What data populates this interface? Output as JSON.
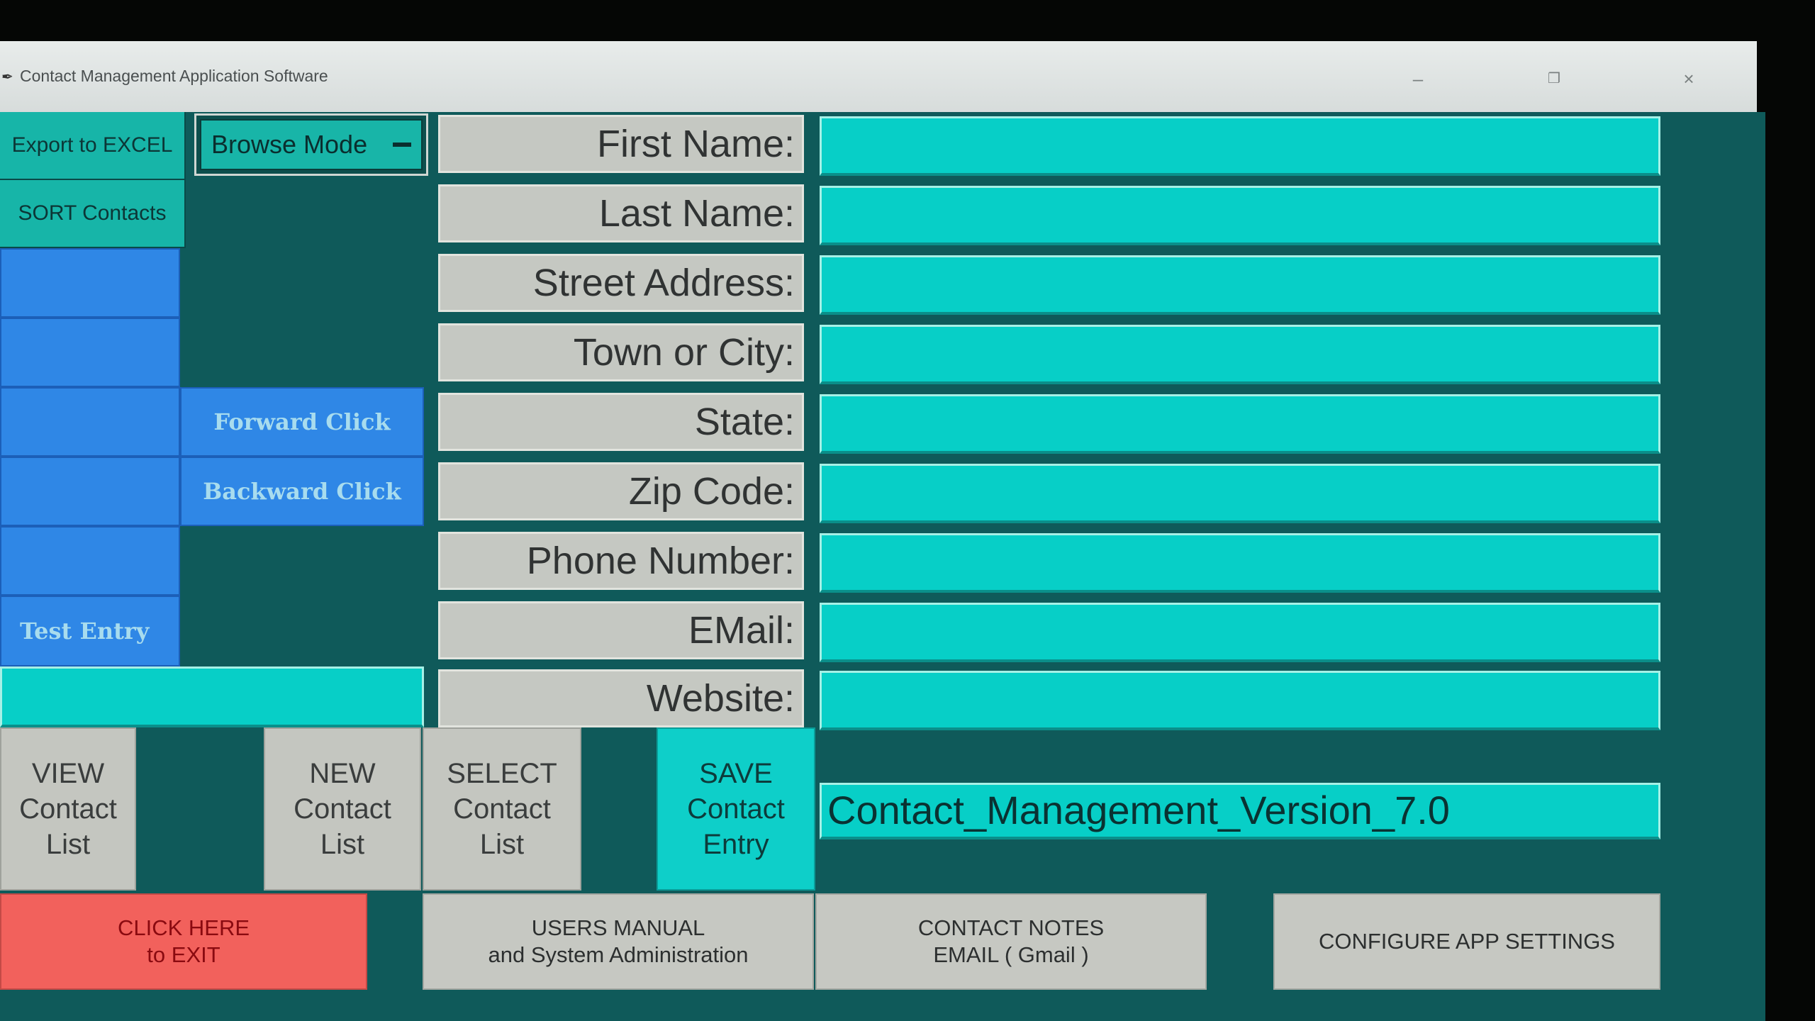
{
  "window": {
    "title": "Contact Management Application Software",
    "minimize": "–",
    "restore": "❐",
    "close": "×"
  },
  "sidebar": {
    "export_label": "Export to EXCEL",
    "sort_label": "SORT Contacts",
    "mode_select": "Browse Mode",
    "forward_label": "Forward Click",
    "backward_label": "Backward Click",
    "test_entry_label": "Test Entry"
  },
  "form": {
    "fields": [
      {
        "label": "First Name:",
        "value": ""
      },
      {
        "label": "Last Name:",
        "value": ""
      },
      {
        "label": "Street Address:",
        "value": ""
      },
      {
        "label": "Town or City:",
        "value": ""
      },
      {
        "label": "State:",
        "value": ""
      },
      {
        "label": "Zip Code:",
        "value": ""
      },
      {
        "label": "Phone Number:",
        "value": ""
      },
      {
        "label": "EMail:",
        "value": ""
      },
      {
        "label": "Website:",
        "value": ""
      }
    ],
    "version_text": "Contact_Management_Version_7.0"
  },
  "actions": {
    "view_list": "VIEW\nContact\nList",
    "new_list": "NEW\nContact\nList",
    "select_list": "SELECT\nContact\nList",
    "save_entry": "SAVE\nContact\nEntry",
    "exit": "CLICK HERE\nto EXIT",
    "manual": "USERS MANUAL\nand System Administration",
    "notes": "CONTACT NOTES\nEMAIL   ( Gmail )",
    "configure": "CONFIGURE APP SETTINGS"
  },
  "colors": {
    "background": "#0f5a5a",
    "field": "#07cfc7",
    "save": "#0ecfc9",
    "exit": "#f2615c",
    "blue_button": "#2f87e6"
  }
}
